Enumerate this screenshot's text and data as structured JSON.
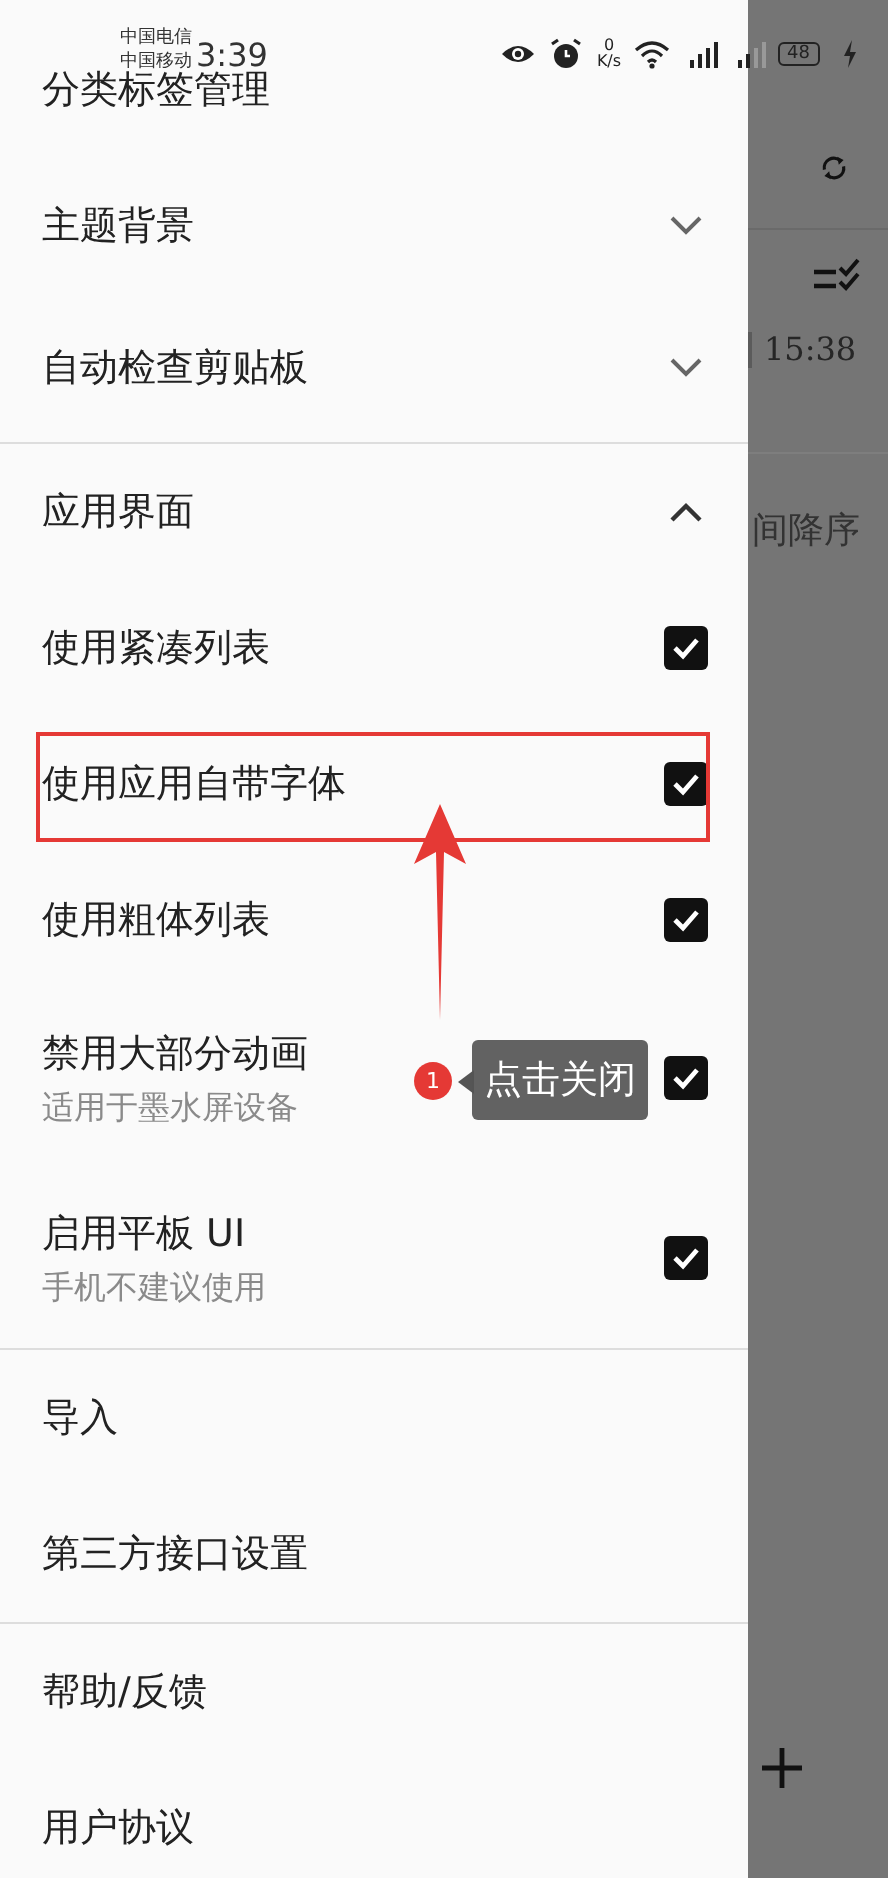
{
  "status_bar": {
    "carriers": [
      "中国电信",
      "中国移动"
    ],
    "time": "3:39",
    "network_speed": {
      "value": "0",
      "unit": "K/s"
    },
    "battery": "48"
  },
  "drawer": {
    "sections": [
      {
        "items": [
          {
            "kind": "link",
            "label": "分类标签管理"
          },
          {
            "kind": "expander",
            "label": "主题背景",
            "expanded": false
          },
          {
            "kind": "expander",
            "label": "自动检查剪贴板",
            "expanded": false
          }
        ]
      },
      {
        "items": [
          {
            "kind": "expander",
            "label": "应用界面",
            "expanded": true
          },
          {
            "kind": "checkbox",
            "label": "使用紧凑列表",
            "checked": true
          },
          {
            "kind": "checkbox",
            "label": "使用应用自带字体",
            "checked": true
          },
          {
            "kind": "checkbox",
            "label": "使用粗体列表",
            "checked": true
          },
          {
            "kind": "checkbox",
            "label": "禁用大部分动画",
            "subtitle": "适用于墨水屏设备",
            "checked": true
          },
          {
            "kind": "checkbox",
            "label": "启用平板 UI",
            "subtitle": "手机不建议使用",
            "checked": true
          }
        ]
      },
      {
        "items": [
          {
            "kind": "link",
            "label": "导入"
          },
          {
            "kind": "link",
            "label": "第三方接口设置"
          }
        ]
      },
      {
        "items": [
          {
            "kind": "link",
            "label": "帮助/反馈"
          },
          {
            "kind": "link",
            "label": "用户协议"
          }
        ]
      }
    ]
  },
  "background_screen": {
    "time": "15:38",
    "sort_label": "间降序"
  },
  "annotation": {
    "step": "1",
    "tooltip": "点击关闭"
  }
}
